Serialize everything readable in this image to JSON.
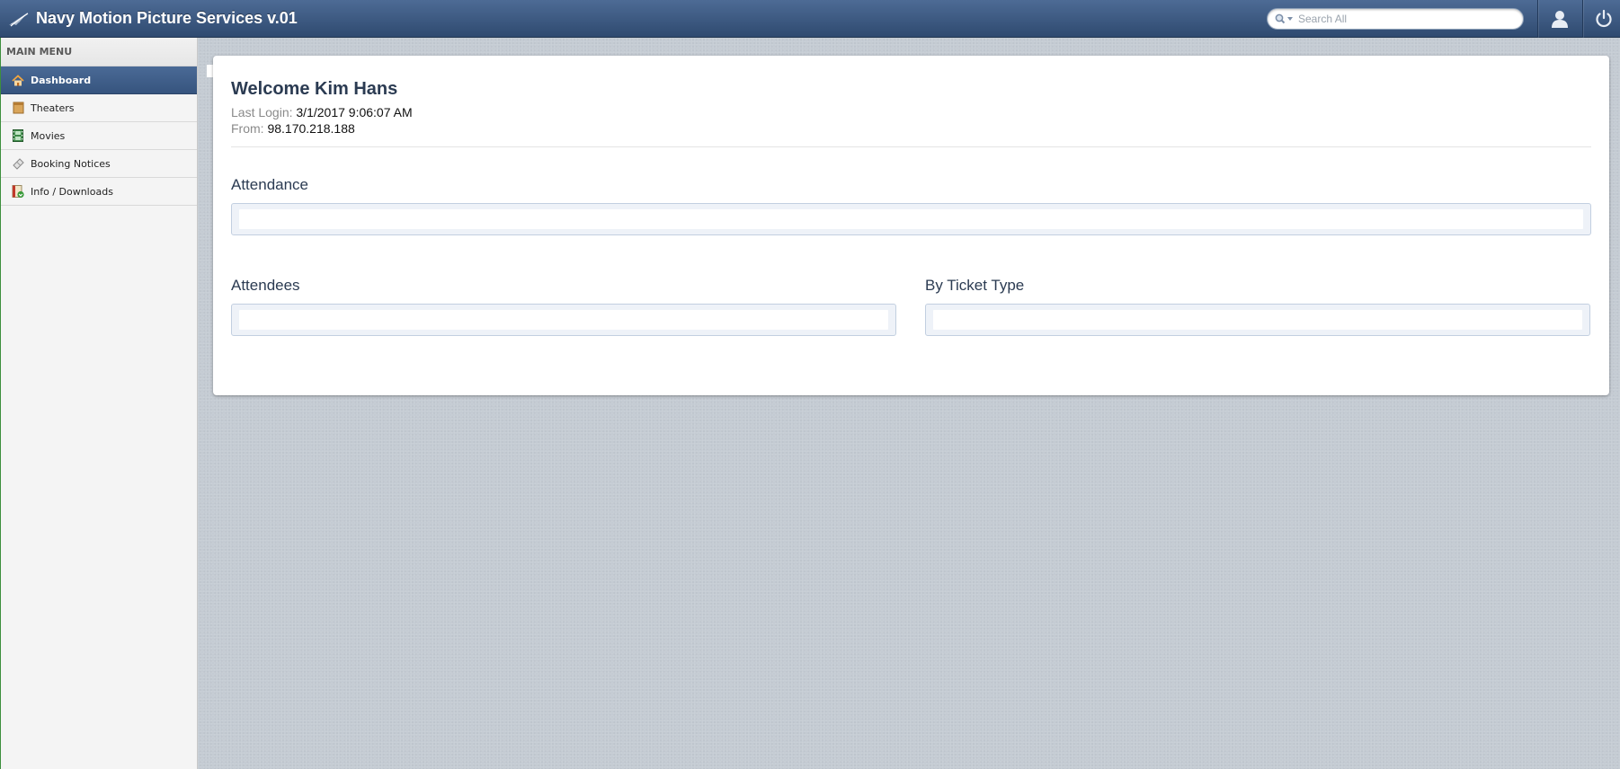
{
  "app": {
    "title": "Navy Motion Picture Services v.01"
  },
  "search": {
    "placeholder": "Search All",
    "value": ""
  },
  "sidebar": {
    "header": "MAIN MENU",
    "items": [
      {
        "label": "Dashboard",
        "icon": "home-icon",
        "active": true
      },
      {
        "label": "Theaters",
        "icon": "theater-icon"
      },
      {
        "label": "Movies",
        "icon": "film-icon"
      },
      {
        "label": "Booking Notices",
        "icon": "ticket-icon"
      },
      {
        "label": "Info / Downloads",
        "icon": "download-icon"
      }
    ]
  },
  "dashboard": {
    "welcome": "Welcome Kim Hans",
    "last_login_label": "Last Login:",
    "last_login_value": "3/1/2017 9:06:07 AM",
    "from_label": "From:",
    "from_value": "98.170.218.188",
    "sections": {
      "attendance": "Attendance",
      "attendees": "Attendees",
      "by_ticket_type": "By Ticket Type"
    }
  },
  "colors": {
    "topbar": "#3d5a83",
    "active_menu": "#3f5f8b",
    "heading": "#2b3b52"
  }
}
